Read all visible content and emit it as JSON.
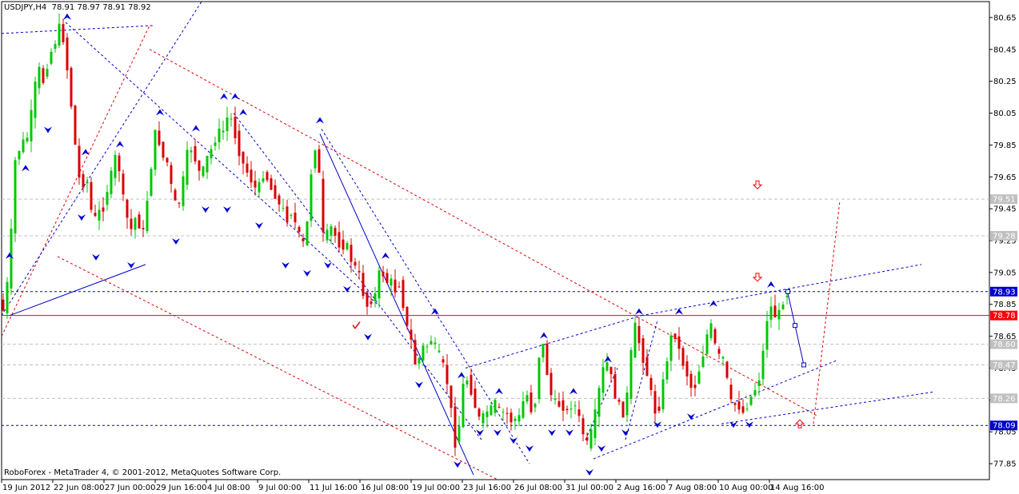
{
  "header": {
    "symbol": "USDJPY,H4",
    "ohlc": "78.91 78.97 78.91 78.92"
  },
  "footer": {
    "copyright": "RoboForex - MetaTrader 4, © 2001-2012, MetaQuotes Software Corp."
  },
  "colors": {
    "background": "#ffffff",
    "bull_candle": "#00c800",
    "bear_candle": "#dc0000",
    "level_line_red": "#ff0000",
    "dotted_blue": "#0000cc",
    "dotted_red": "#dd0000",
    "solid_blue": "#0000cc",
    "fractal_blue": "#0000cc",
    "price_tag_red": "#ff0000",
    "price_tag_blue": "#0000cc",
    "price_tag_gray": "#c0c0c0"
  },
  "chart_data": {
    "type": "candlestick",
    "symbol": "USDJPY",
    "timeframe": "H4",
    "ylim": [
      77.75,
      80.75
    ],
    "price_ticks": [
      "80.65",
      "80.45",
      "80.25",
      "80.05",
      "79.85",
      "79.65",
      "79.45",
      "79.25",
      "79.05",
      "78.85",
      "78.65",
      "78.45",
      "78.25",
      "78.05",
      "77.85"
    ],
    "date_labels": [
      "19 Jun 2012",
      "22 Jun 08:00",
      "27 Jun 00:00",
      "29 Jun 16:00",
      "4 Jul 08:00",
      "9 Jul 00:00",
      "11 Jul 16:00",
      "16 Jul 08:00",
      "19 Jul 00:00",
      "23 Jul 16:00",
      "26 Jul 08:00",
      "31 Jul 00:00",
      "2 Aug 16:00",
      "7 Aug 08:00",
      "10 Aug 00:00",
      "14 Aug 16:00"
    ],
    "price_tags": [
      {
        "label": "79.51",
        "value": 79.51,
        "style": "gray"
      },
      {
        "label": "79.28",
        "value": 79.28,
        "style": "gray"
      },
      {
        "label": "78.93",
        "value": 78.93,
        "style": "blue"
      },
      {
        "label": "78.78",
        "value": 78.78,
        "style": "red"
      },
      {
        "label": "78.60",
        "value": 78.6,
        "style": "gray"
      },
      {
        "label": "78.47",
        "value": 78.47,
        "style": "gray"
      },
      {
        "label": "78.26",
        "value": 78.26,
        "style": "gray"
      },
      {
        "label": "78.09",
        "value": 78.09,
        "style": "blue"
      }
    ],
    "horizontal_levels": [
      {
        "value": 79.51,
        "style": "gray-dash"
      },
      {
        "value": 79.28,
        "style": "gray-dash"
      },
      {
        "value": 78.93,
        "style": "blue-dash"
      },
      {
        "value": 78.78,
        "style": "red-solid"
      },
      {
        "value": 78.6,
        "style": "gray-dash"
      },
      {
        "value": 78.47,
        "style": "gray-dash"
      },
      {
        "value": 78.26,
        "style": "gray-dash"
      },
      {
        "value": 78.09,
        "style": "blue-dash"
      }
    ],
    "price_path": [
      [
        0,
        78.88
      ],
      [
        4,
        78.78
      ],
      [
        8,
        78.9
      ],
      [
        12,
        79.05
      ],
      [
        15,
        79.3
      ],
      [
        20,
        79.75
      ],
      [
        27,
        79.85
      ],
      [
        35,
        79.9
      ],
      [
        42,
        80.1
      ],
      [
        48,
        80.35
      ],
      [
        55,
        80.25
      ],
      [
        62,
        80.4
      ],
      [
        70,
        80.5
      ],
      [
        77,
        80.62
      ],
      [
        82,
        80.45
      ],
      [
        88,
        80.2
      ],
      [
        93,
        79.95
      ],
      [
        98,
        79.7
      ],
      [
        103,
        79.55
      ],
      [
        108,
        79.7
      ],
      [
        113,
        79.5
      ],
      [
        118,
        79.35
      ],
      [
        123,
        79.45
      ],
      [
        128,
        79.4
      ],
      [
        133,
        79.55
      ],
      [
        138,
        79.6
      ],
      [
        143,
        79.75
      ],
      [
        148,
        79.8
      ],
      [
        153,
        79.55
      ],
      [
        158,
        79.45
      ],
      [
        163,
        79.3
      ],
      [
        168,
        79.35
      ],
      [
        173,
        79.45
      ],
      [
        178,
        79.2
      ],
      [
        183,
        79.45
      ],
      [
        188,
        79.6
      ],
      [
        193,
        79.9
      ],
      [
        198,
        79.95
      ],
      [
        203,
        79.75
      ],
      [
        208,
        79.8
      ],
      [
        213,
        79.65
      ],
      [
        218,
        79.5
      ],
      [
        223,
        79.45
      ],
      [
        228,
        79.55
      ],
      [
        233,
        79.75
      ],
      [
        238,
        79.85
      ],
      [
        243,
        79.8
      ],
      [
        248,
        79.7
      ],
      [
        253,
        79.65
      ],
      [
        258,
        79.75
      ],
      [
        263,
        79.8
      ],
      [
        268,
        79.85
      ],
      [
        273,
        79.95
      ],
      [
        278,
        79.9
      ],
      [
        283,
        80.0
      ],
      [
        288,
        80.05
      ],
      [
        293,
        79.95
      ],
      [
        298,
        79.85
      ],
      [
        303,
        79.75
      ],
      [
        308,
        79.7
      ],
      [
        313,
        79.65
      ],
      [
        318,
        79.6
      ],
      [
        323,
        79.55
      ],
      [
        328,
        79.65
      ],
      [
        333,
        79.7
      ],
      [
        338,
        79.55
      ],
      [
        343,
        79.6
      ],
      [
        348,
        79.45
      ],
      [
        353,
        79.5
      ],
      [
        358,
        79.35
      ],
      [
        363,
        79.45
      ],
      [
        368,
        79.4
      ],
      [
        373,
        79.3
      ],
      [
        378,
        79.25
      ],
      [
        383,
        79.2
      ],
      [
        388,
        79.6
      ],
      [
        393,
        79.8
      ],
      [
        398,
        79.9
      ],
      [
        403,
        79.3
      ],
      [
        408,
        79.25
      ],
      [
        413,
        79.35
      ],
      [
        418,
        79.3
      ],
      [
        423,
        79.25
      ],
      [
        428,
        79.2
      ],
      [
        433,
        79.25
      ],
      [
        438,
        79.15
      ],
      [
        443,
        79.1
      ],
      [
        448,
        79.05
      ],
      [
        453,
        79.0
      ],
      [
        458,
        78.8
      ],
      [
        463,
        78.9
      ],
      [
        468,
        78.85
      ],
      [
        473,
        79.0
      ],
      [
        478,
        79.1
      ],
      [
        483,
        78.95
      ],
      [
        488,
        79.05
      ],
      [
        493,
        78.9
      ],
      [
        498,
        79.0
      ],
      [
        503,
        78.95
      ],
      [
        508,
        78.7
      ],
      [
        513,
        78.7
      ],
      [
        518,
        78.5
      ],
      [
        523,
        78.45
      ],
      [
        528,
        78.6
      ],
      [
        533,
        78.55
      ],
      [
        538,
        78.65
      ],
      [
        543,
        78.6
      ],
      [
        548,
        78.55
      ],
      [
        553,
        78.5
      ],
      [
        558,
        78.4
      ],
      [
        563,
        78.3
      ],
      [
        568,
        78.0
      ],
      [
        573,
        77.95
      ],
      [
        578,
        78.3
      ],
      [
        583,
        78.4
      ],
      [
        588,
        78.35
      ],
      [
        593,
        78.25
      ],
      [
        598,
        78.15
      ],
      [
        603,
        78.1
      ],
      [
        608,
        78.2
      ],
      [
        613,
        78.15
      ],
      [
        618,
        78.25
      ],
      [
        623,
        78.2
      ],
      [
        628,
        78.15
      ],
      [
        633,
        78.2
      ],
      [
        638,
        78.1
      ],
      [
        643,
        78.15
      ],
      [
        648,
        78.1
      ],
      [
        653,
        78.2
      ],
      [
        658,
        78.3
      ],
      [
        663,
        78.25
      ],
      [
        668,
        78.1
      ],
      [
        673,
        78.45
      ],
      [
        678,
        78.65
      ],
      [
        683,
        78.5
      ],
      [
        688,
        78.3
      ],
      [
        693,
        78.25
      ],
      [
        698,
        78.2
      ],
      [
        703,
        78.25
      ],
      [
        708,
        78.15
      ],
      [
        713,
        78.2
      ],
      [
        718,
        78.25
      ],
      [
        723,
        78.15
      ],
      [
        728,
        78.1
      ],
      [
        733,
        77.95
      ],
      [
        738,
        78.0
      ],
      [
        743,
        78.1
      ],
      [
        748,
        78.25
      ],
      [
        753,
        78.4
      ],
      [
        758,
        78.5
      ],
      [
        763,
        78.45
      ],
      [
        768,
        78.3
      ],
      [
        773,
        78.25
      ],
      [
        778,
        78.15
      ],
      [
        783,
        78.2
      ],
      [
        788,
        78.4
      ],
      [
        793,
        78.75
      ],
      [
        798,
        78.65
      ],
      [
        803,
        78.55
      ],
      [
        808,
        78.45
      ],
      [
        813,
        78.35
      ],
      [
        818,
        78.2
      ],
      [
        823,
        78.15
      ],
      [
        828,
        78.3
      ],
      [
        833,
        78.45
      ],
      [
        838,
        78.6
      ],
      [
        843,
        78.7
      ],
      [
        848,
        78.6
      ],
      [
        853,
        78.5
      ],
      [
        858,
        78.45
      ],
      [
        863,
        78.35
      ],
      [
        868,
        78.3
      ],
      [
        873,
        78.4
      ],
      [
        878,
        78.5
      ],
      [
        883,
        78.6
      ],
      [
        888,
        78.75
      ],
      [
        893,
        78.65
      ],
      [
        898,
        78.5
      ],
      [
        903,
        78.55
      ],
      [
        908,
        78.45
      ],
      [
        913,
        78.25
      ],
      [
        918,
        78.2
      ],
      [
        923,
        78.25
      ],
      [
        928,
        78.15
      ],
      [
        933,
        78.2
      ],
      [
        938,
        78.25
      ],
      [
        943,
        78.3
      ],
      [
        948,
        78.35
      ],
      [
        953,
        78.45
      ],
      [
        958,
        78.7
      ],
      [
        963,
        78.85
      ],
      [
        968,
        78.8
      ],
      [
        973,
        78.75
      ],
      [
        978,
        78.85
      ],
      [
        983,
        78.92
      ]
    ],
    "dotted_blue_lines": [
      [
        [
          0,
          78.78
        ],
        [
          250,
          80.75
        ]
      ],
      [
        [
          0,
          80.55
        ],
        [
          190,
          80.6
        ]
      ],
      [
        [
          80,
          80.62
        ],
        [
          470,
          78.85
        ]
      ],
      [
        [
          290,
          80.05
        ],
        [
          600,
          78.0
        ]
      ],
      [
        [
          400,
          79.95
        ],
        [
          660,
          77.85
        ]
      ],
      [
        [
          580,
          78.45
        ],
        [
          800,
          78.78
        ]
      ],
      [
        [
          800,
          78.78
        ],
        [
          1150,
          79.1
        ]
      ],
      [
        [
          740,
          77.88
        ],
        [
          1045,
          78.5
        ]
      ],
      [
        [
          900,
          78.1
        ],
        [
          1165,
          78.3
        ]
      ],
      [
        [
          730,
          78.0
        ],
        [
          770,
          78.45
        ]
      ],
      [
        [
          780,
          78.0
        ],
        [
          820,
          78.75
        ]
      ]
    ],
    "dotted_red_lines": [
      [
        [
          0,
          78.65
        ],
        [
          185,
          80.6
        ]
      ],
      [
        [
          185,
          80.45
        ],
        [
          1020,
          78.15
        ]
      ],
      [
        [
          70,
          79.15
        ],
        [
          620,
          77.75
        ]
      ],
      [
        [
          1015,
          78.1
        ],
        [
          1048,
          79.5
        ]
      ]
    ],
    "solid_blue_lines": [
      [
        [
          10,
          78.78
        ],
        [
          180,
          79.1
        ]
      ],
      [
        [
          398,
          79.92
        ],
        [
          590,
          77.78
        ]
      ],
      [
        [
          983,
          78.92
        ],
        [
          1003,
          78.47
        ]
      ]
    ],
    "fractals_up": [
      [
        10,
        79.15
      ],
      [
        30,
        79.7
      ],
      [
        82,
        80.65
      ],
      [
        105,
        79.8
      ],
      [
        148,
        79.85
      ],
      [
        198,
        80.05
      ],
      [
        243,
        79.95
      ],
      [
        278,
        80.15
      ],
      [
        292,
        80.15
      ],
      [
        302,
        80.05
      ],
      [
        398,
        80.0
      ],
      [
        480,
        79.15
      ],
      [
        542,
        78.8
      ],
      [
        575,
        78.4
      ],
      [
        622,
        78.3
      ],
      [
        678,
        78.65
      ],
      [
        715,
        78.3
      ],
      [
        758,
        78.5
      ],
      [
        797,
        78.8
      ],
      [
        847,
        78.8
      ],
      [
        890,
        78.85
      ],
      [
        962,
        78.97
      ]
    ],
    "fractals_down": [
      [
        58,
        79.95
      ],
      [
        100,
        79.4
      ],
      [
        118,
        79.15
      ],
      [
        162,
        79.1
      ],
      [
        218,
        79.25
      ],
      [
        255,
        79.45
      ],
      [
        282,
        79.45
      ],
      [
        322,
        79.35
      ],
      [
        355,
        79.1
      ],
      [
        382,
        79.05
      ],
      [
        408,
        79.1
      ],
      [
        432,
        78.95
      ],
      [
        458,
        78.65
      ],
      [
        522,
        78.35
      ],
      [
        570,
        77.85
      ],
      [
        598,
        78.05
      ],
      [
        620,
        78.05
      ],
      [
        640,
        78.0
      ],
      [
        660,
        77.95
      ],
      [
        688,
        78.05
      ],
      [
        710,
        78.05
      ],
      [
        735,
        77.8
      ],
      [
        750,
        77.95
      ],
      [
        780,
        78.05
      ],
      [
        820,
        78.1
      ],
      [
        862,
        78.15
      ],
      [
        915,
        78.1
      ],
      [
        935,
        78.1
      ]
    ],
    "arrows_down": [
      [
        945,
        79.6
      ],
      [
        945,
        79.02
      ]
    ],
    "arrows_up": [
      [
        998,
        78.1
      ]
    ],
    "check_mark": [
      443,
      78.72
    ],
    "projection_square": [
      983,
      78.93
    ]
  }
}
